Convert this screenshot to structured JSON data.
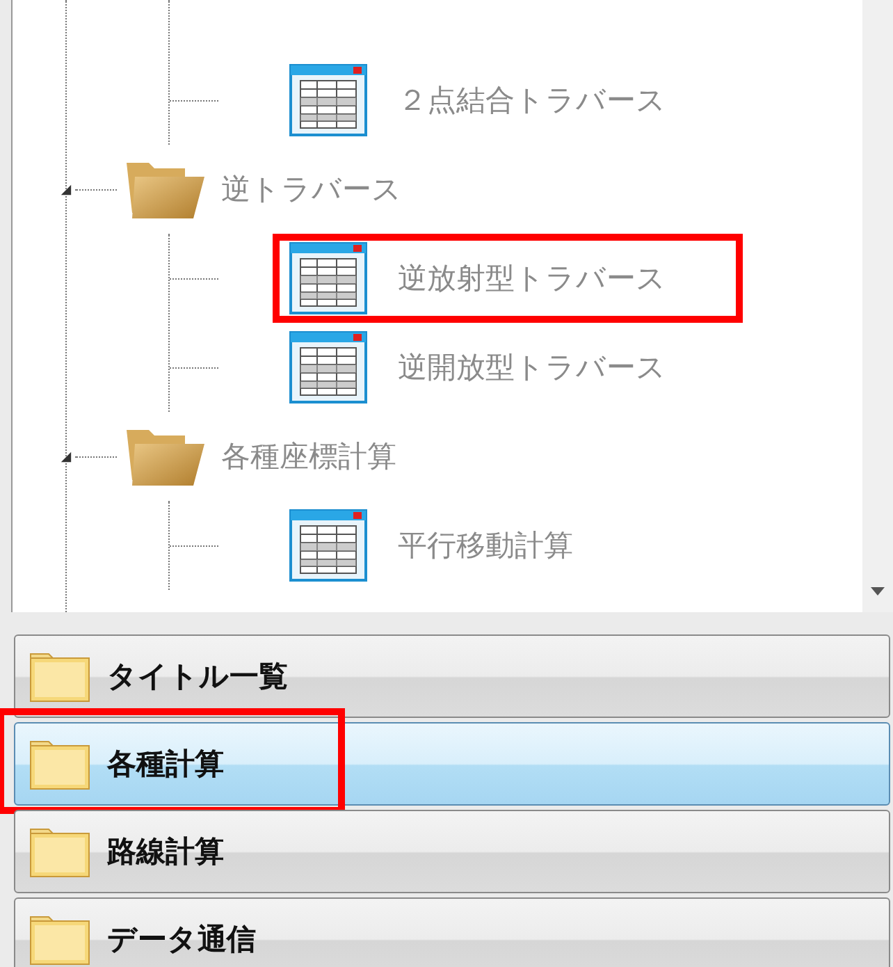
{
  "tree": [
    {
      "kind": "continued",
      "children": [
        {
          "label": "２点結合トラバース",
          "highlighted": false
        }
      ]
    },
    {
      "kind": "folder",
      "label": "逆トラバース",
      "expanded": true,
      "children": [
        {
          "label": "逆放射型トラバース",
          "highlighted": true
        },
        {
          "label": "逆開放型トラバース",
          "highlighted": false
        }
      ]
    },
    {
      "kind": "folder",
      "label": "各種座標計算",
      "expanded": true,
      "children": [
        {
          "label": "平行移動計算",
          "highlighted": false
        }
      ]
    }
  ],
  "nav": [
    {
      "label": "タイトル一覧",
      "selected": false,
      "highlighted": false
    },
    {
      "label": "各種計算",
      "selected": true,
      "highlighted": true
    },
    {
      "label": "路線計算",
      "selected": false,
      "highlighted": false
    },
    {
      "label": "データ通信",
      "selected": false,
      "highlighted": false
    }
  ]
}
